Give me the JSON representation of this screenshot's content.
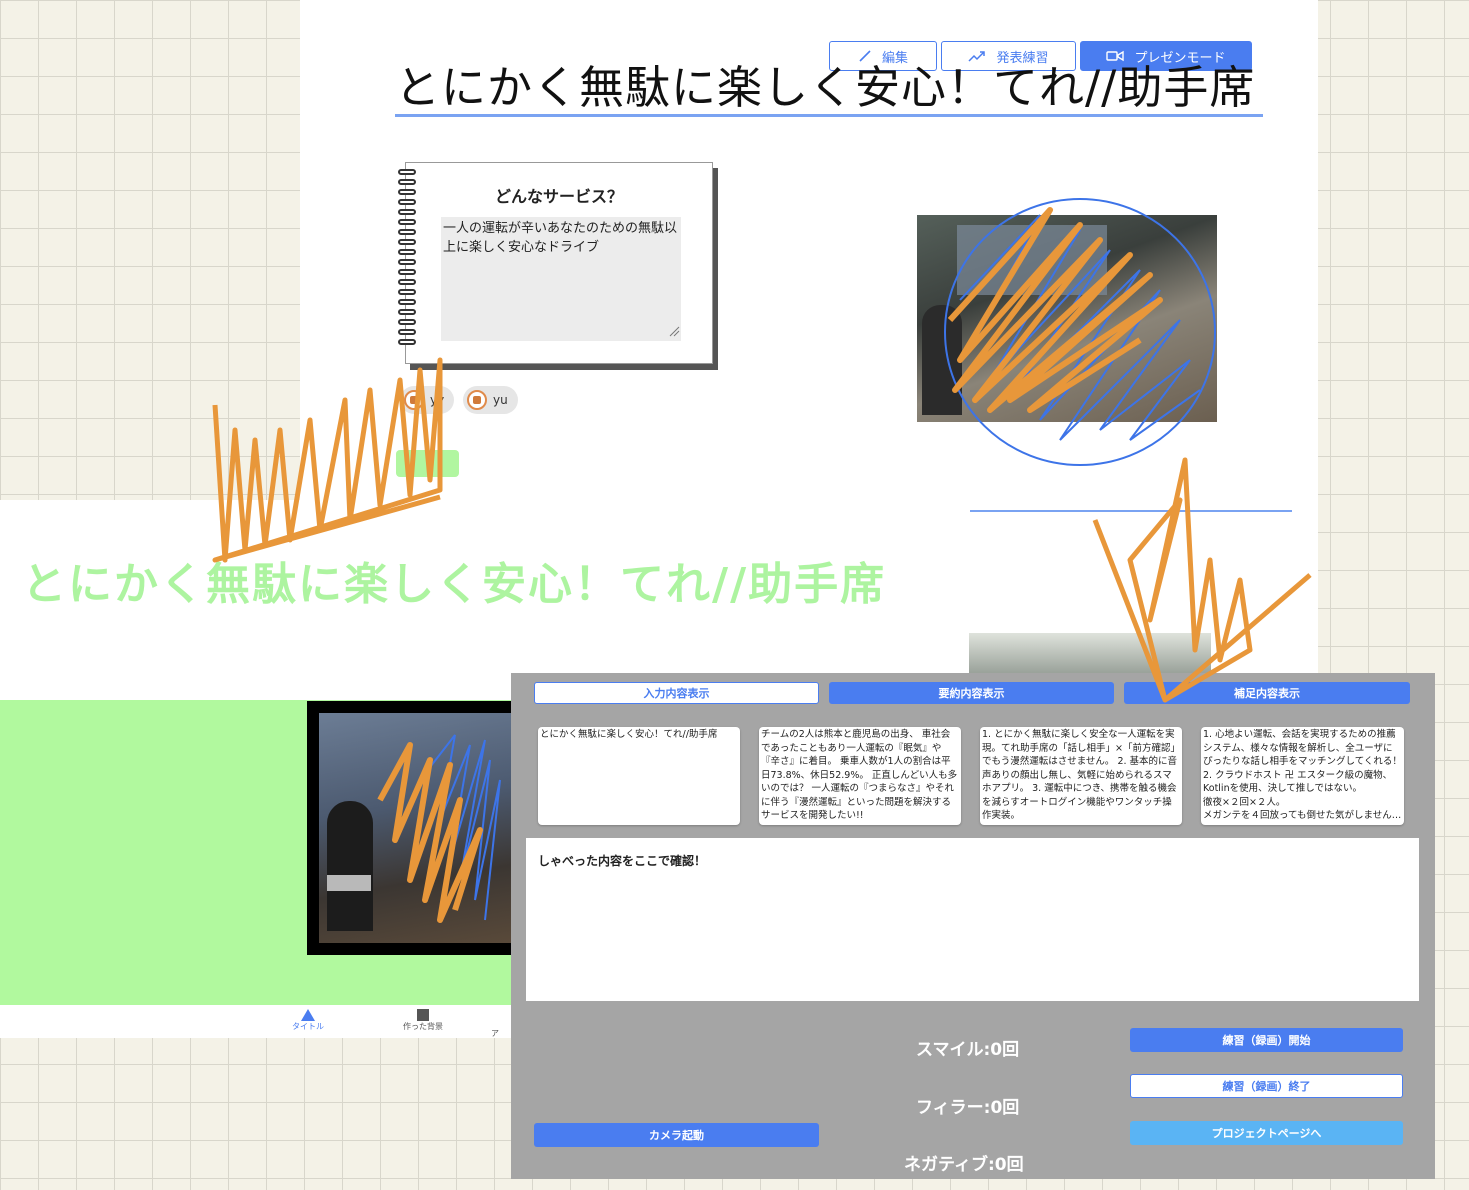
{
  "toolbar": {
    "edit_label": "編集",
    "practice_label": "発表練習",
    "present_label": "プレゼンモード"
  },
  "slide": {
    "title": "とにかく無駄に楽しく安心！てれ//助手席",
    "card_heading": "どんなサービス？",
    "card_text": "一人の運転が辛いあなたのための無駄以上に楽しく安心なドライブ",
    "members": [
      "yy",
      "yu"
    ]
  },
  "preview": {
    "big_title": "とにかく無駄に楽しく安心！てれ//助手席",
    "nav": [
      {
        "label": "タイトル",
        "icon": "triangle-icon"
      },
      {
        "label": "作った背景",
        "icon": "square-icon"
      },
      {
        "label": "ア",
        "icon": "circle-icon"
      }
    ]
  },
  "panel": {
    "tabs": [
      "入力内容表示",
      "要約内容表示",
      "補足内容表示"
    ],
    "cards": [
      "とにかく無駄に楽しく安心！てれ//助手席",
      "チームの2人は熊本と鹿児島の出身、 車社会であったこともあり一人運転の『眠気』や『辛さ』に着目。 乗車人数が1人の割合は平日73.8%、休日52.9%。 正直しんどい人も多いのでは？ 一人運転の『つまらなさ』やそれに伴う『漫然運転』といった問題を解決するサービスを開発したい!!",
      "1. とにかく無駄に楽しく安全な一人運転を実現。てれ助手席の「話し相手」×「前方確認」でもう漫然運転はさせません。 2. 基本的に音声ありの顔出し無し、気軽に始められるスマホアプリ。 3. 運転中につき、携帯を触る機会を減らすオートログイン機能やワンタッチ操作実装。",
      "1. 心地よい運転、会話を実現するための推薦システム、様々な情報を解析し、全ユーザにぴったりな話し相手をマッチングしてくれる！ 2. クラウドホスト 卍 エスターク級の魔物、Kotlinを使用、決して推しではない。\n徹夜×２回×２人。\nメガンテを４回放っても倒せた気がしません…"
    ],
    "speech_placeholder": "しゃべった内容をここで確認！",
    "counts": {
      "smile": "スマイル:0回",
      "filler": "フィラー:0回",
      "negative": "ネガティブ:0回"
    },
    "buttons": {
      "start": "練習（録画）開始",
      "stop": "練習（録画）終了",
      "project": "プロジェクトページへ",
      "camera": "カメラ起動"
    }
  },
  "colors": {
    "accent": "#4a7df0",
    "green": "#b1f99e",
    "scribble_orange": "#e8973a",
    "scribble_blue": "#3d74e8",
    "panel_gray": "#a5a5a5"
  }
}
